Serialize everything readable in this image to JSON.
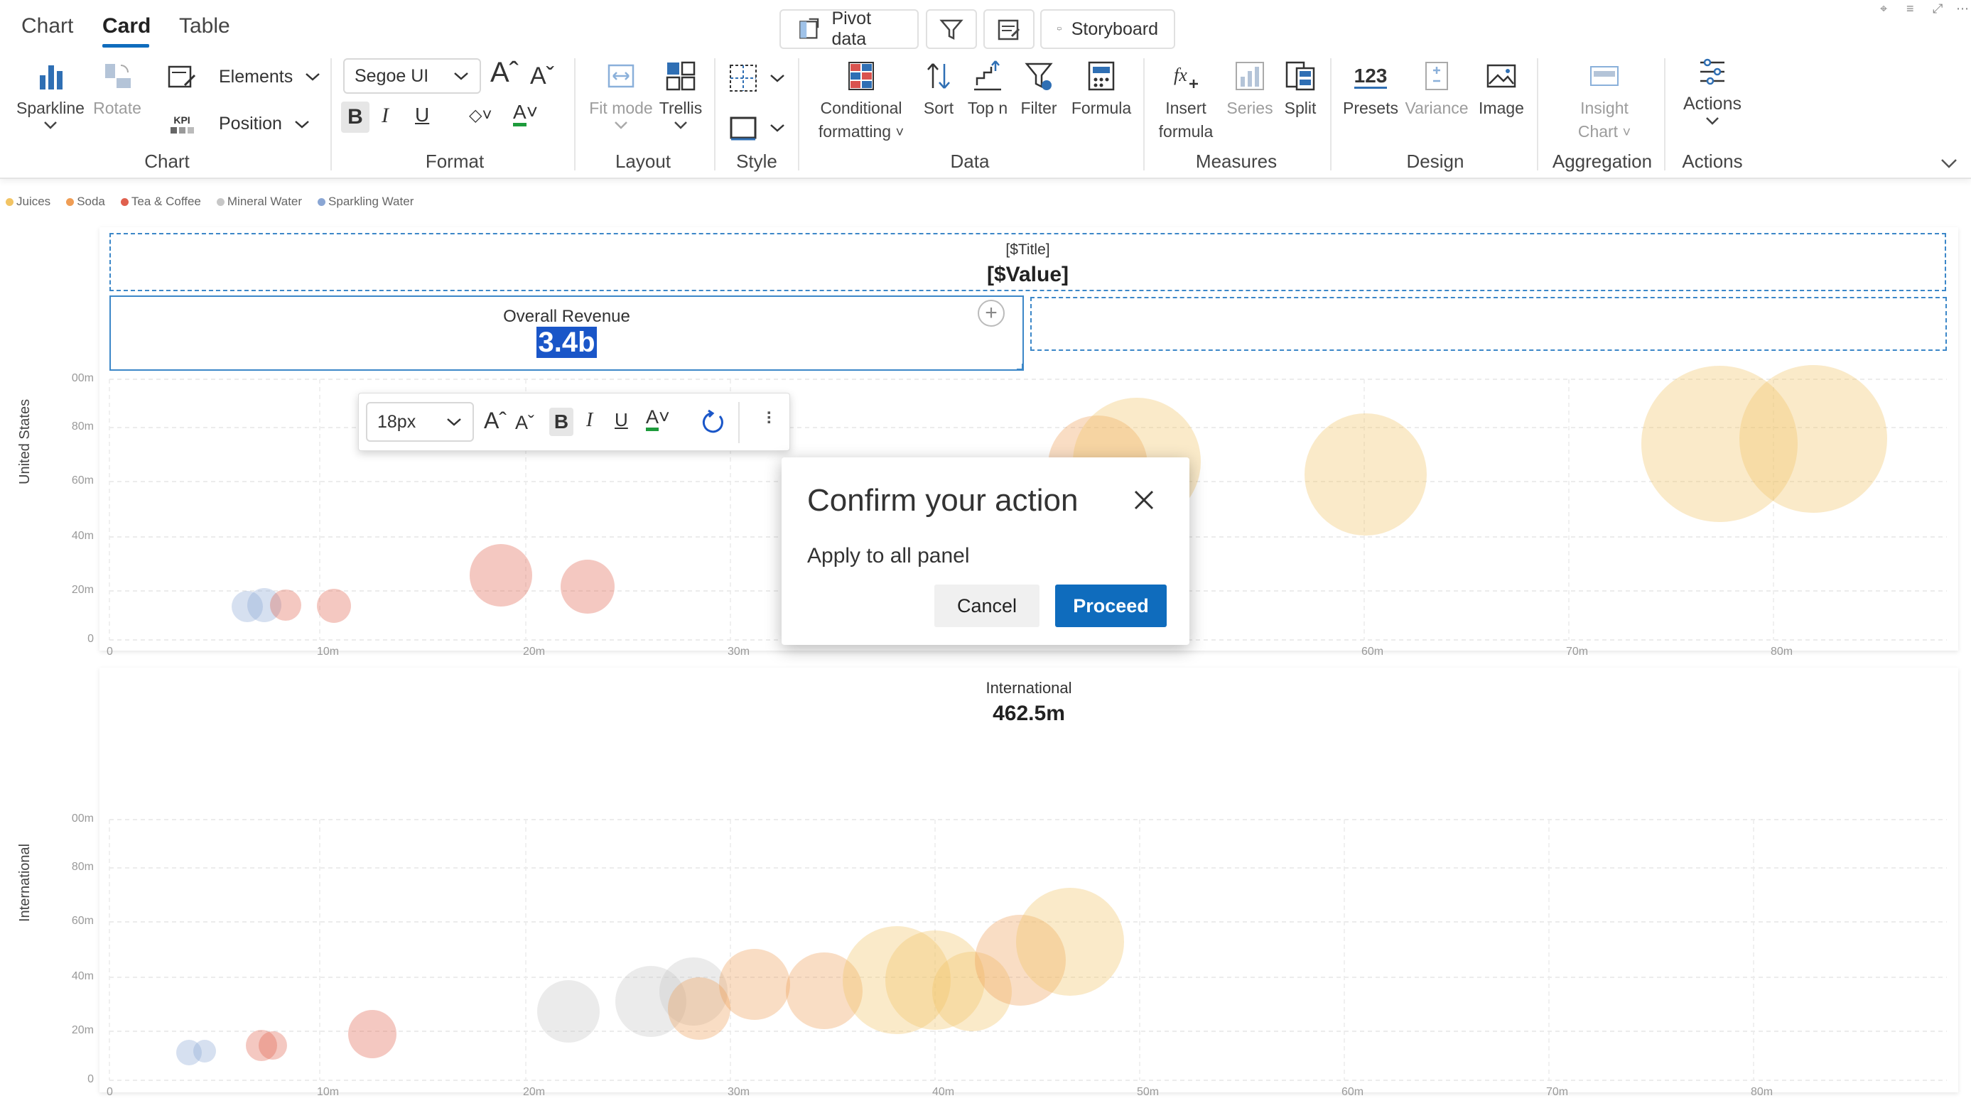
{
  "tabs": [
    {
      "label": "Chart"
    },
    {
      "label": "Card"
    },
    {
      "label": "Table"
    }
  ],
  "top_tools": {
    "pivot_data": "Pivot data",
    "storyboard": "Storyboard"
  },
  "ribbon": {
    "chart_group": {
      "label": "Chart",
      "sparkline": "Sparkline",
      "rotate": "Rotate",
      "elements": "Elements",
      "position": "Position",
      "kpi_icon_text": "KPI"
    },
    "format_group": {
      "label": "Format",
      "font": "Segoe UI"
    },
    "layout_group": {
      "label": "Layout",
      "fit_mode": "Fit mode",
      "trellis": "Trellis"
    },
    "style_group": {
      "label": "Style"
    },
    "data_group": {
      "label": "Data",
      "conditional": "Conditional",
      "formatting": "formatting",
      "sort": "Sort",
      "top_n": "Top n",
      "filter": "Filter",
      "formula": "Formula"
    },
    "measures_group": {
      "label": "Measures",
      "insert": "Insert",
      "formula": "formula",
      "series": "Series",
      "split": "Split"
    },
    "design_group": {
      "label": "Design",
      "presets": "Presets",
      "presets_icon_text": "123",
      "variance": "Variance",
      "image": "Image"
    },
    "aggregation_group": {
      "label": "Aggregation",
      "insight": "Insight",
      "chart": "Chart"
    },
    "actions_group": {
      "label": "Actions",
      "actions": "Actions"
    }
  },
  "legend": [
    {
      "name": "Juices",
      "color": "#f2c464"
    },
    {
      "name": "Soda",
      "color": "#ef9d55"
    },
    {
      "name": "Tea & Coffee",
      "color": "#e0604e"
    },
    {
      "name": "Mineral Water",
      "color": "#c7c7c7"
    },
    {
      "name": "Sparkling Water",
      "color": "#8aa6d4"
    }
  ],
  "panel_us": {
    "axis_title": "United States",
    "placeholder_title": "[$Title]",
    "placeholder_value": "[$Value]",
    "card_title": "Overall Revenue",
    "card_value": "3.4b",
    "y_ticks": [
      "00m",
      "80m",
      "60m",
      "40m",
      "20m",
      "0"
    ],
    "x_ticks": [
      "0",
      "10m",
      "20m",
      "30m",
      "60m",
      "70m",
      "80m"
    ]
  },
  "panel_intl": {
    "axis_title": "International",
    "card_title": "International",
    "card_value": "462.5m",
    "y_ticks": [
      "00m",
      "80m",
      "60m",
      "40m",
      "20m",
      "0"
    ],
    "x_ticks": [
      "0",
      "10m",
      "20m",
      "30m",
      "40m",
      "50m",
      "60m",
      "70m",
      "80m"
    ]
  },
  "float_toolbar": {
    "font_size": "18px"
  },
  "dialog": {
    "title": "Confirm your action",
    "body": "Apply to all panel",
    "cancel": "Cancel",
    "proceed": "Proceed"
  },
  "colors": {
    "accent": "#0f6cbd",
    "selection": "#1a56c8"
  }
}
